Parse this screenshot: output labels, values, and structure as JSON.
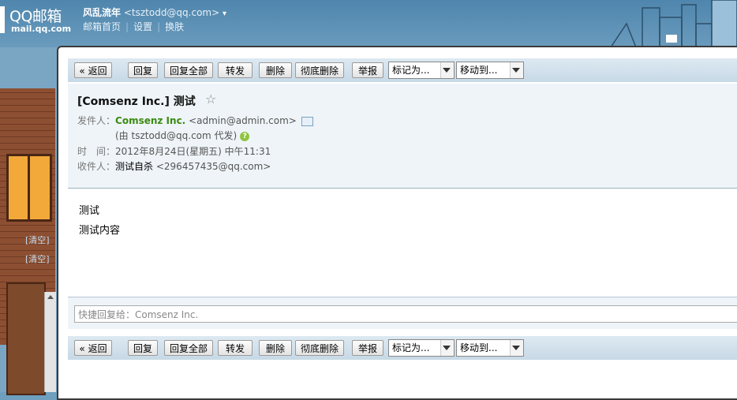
{
  "brand": {
    "name": "QQ邮箱",
    "sub": "mail.qq.com"
  },
  "user": {
    "nickname": "风乱流年",
    "email": "<tsztodd@qq.com>",
    "caret": "▾"
  },
  "top_links": [
    "邮箱首页",
    "设置",
    "换肤"
  ],
  "left_links": [
    "[清空]",
    "[清空]"
  ],
  "toolbar": {
    "back": "« 返回",
    "reply": "回复",
    "reply_all": "回复全部",
    "forward": "转发",
    "delete": "删除",
    "delete_permanent": "彻底删除",
    "report": "举报",
    "mark_as": "标记为...",
    "move_to": "移动到..."
  },
  "message": {
    "subject": "[Comsenz Inc.] 测试",
    "star": "☆",
    "from_label": "发件人：",
    "from_name": "Comsenz Inc.",
    "from_email": "<admin@admin.com>",
    "proxy_note": "(由 tsztodd@qq.com 代发)",
    "time_label": "时　间：",
    "time_value": "2012年8月24日(星期五) 中午11:31",
    "to_label": "收件人：",
    "to_name": "测试自杀",
    "to_email": "<296457435@qq.com>",
    "body_lines": [
      "测试",
      "测试内容"
    ]
  },
  "quick_reply": {
    "placeholder": "快捷回复给：Comsenz Inc."
  }
}
